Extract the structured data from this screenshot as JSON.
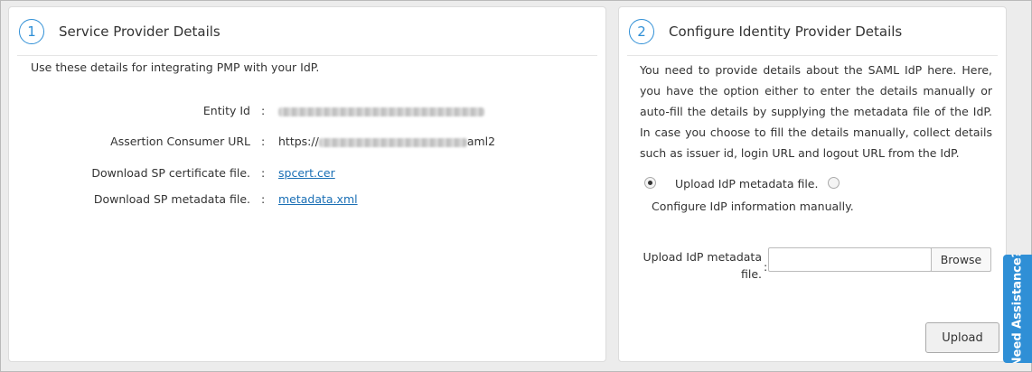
{
  "left_panel": {
    "step": "1",
    "title": "Service Provider Details",
    "intro": "Use these details for integrating PMP with your IdP.",
    "rows": [
      {
        "label": "Entity Id",
        "colon": ":",
        "value_prefix": "",
        "value_suffix": ""
      },
      {
        "label": "Assertion Consumer URL",
        "colon": ":",
        "value_prefix": "https://",
        "value_suffix": "aml2"
      },
      {
        "label": "Download SP certificate file.",
        "colon": ":",
        "link": "spcert.cer"
      },
      {
        "label": "Download SP metadata file.",
        "colon": ":",
        "link": "metadata.xml"
      }
    ]
  },
  "right_panel": {
    "step": "2",
    "title": "Configure Identity Provider Details",
    "description": "You need to provide details about the SAML IdP here. Here, you have the option either to enter the details manually or auto-fill the details by supplying the metadata file of the IdP. In case you choose to fill the details manually, collect details such as issuer id, login URL and logout URL from the IdP.",
    "radio_upload_label": "Upload IdP metadata file.",
    "radio_manual_label": "Configure IdP information manually.",
    "upload_field_label_line1": "Upload IdP metadata",
    "upload_field_label_line2": "file.",
    "upload_field_colon": ":",
    "browse_label": "Browse",
    "upload_button_label": "Upload"
  },
  "assist_tab_label": "Need Assistance?",
  "colors": {
    "accent": "#2f8fd6",
    "link": "#1a6fb5"
  }
}
